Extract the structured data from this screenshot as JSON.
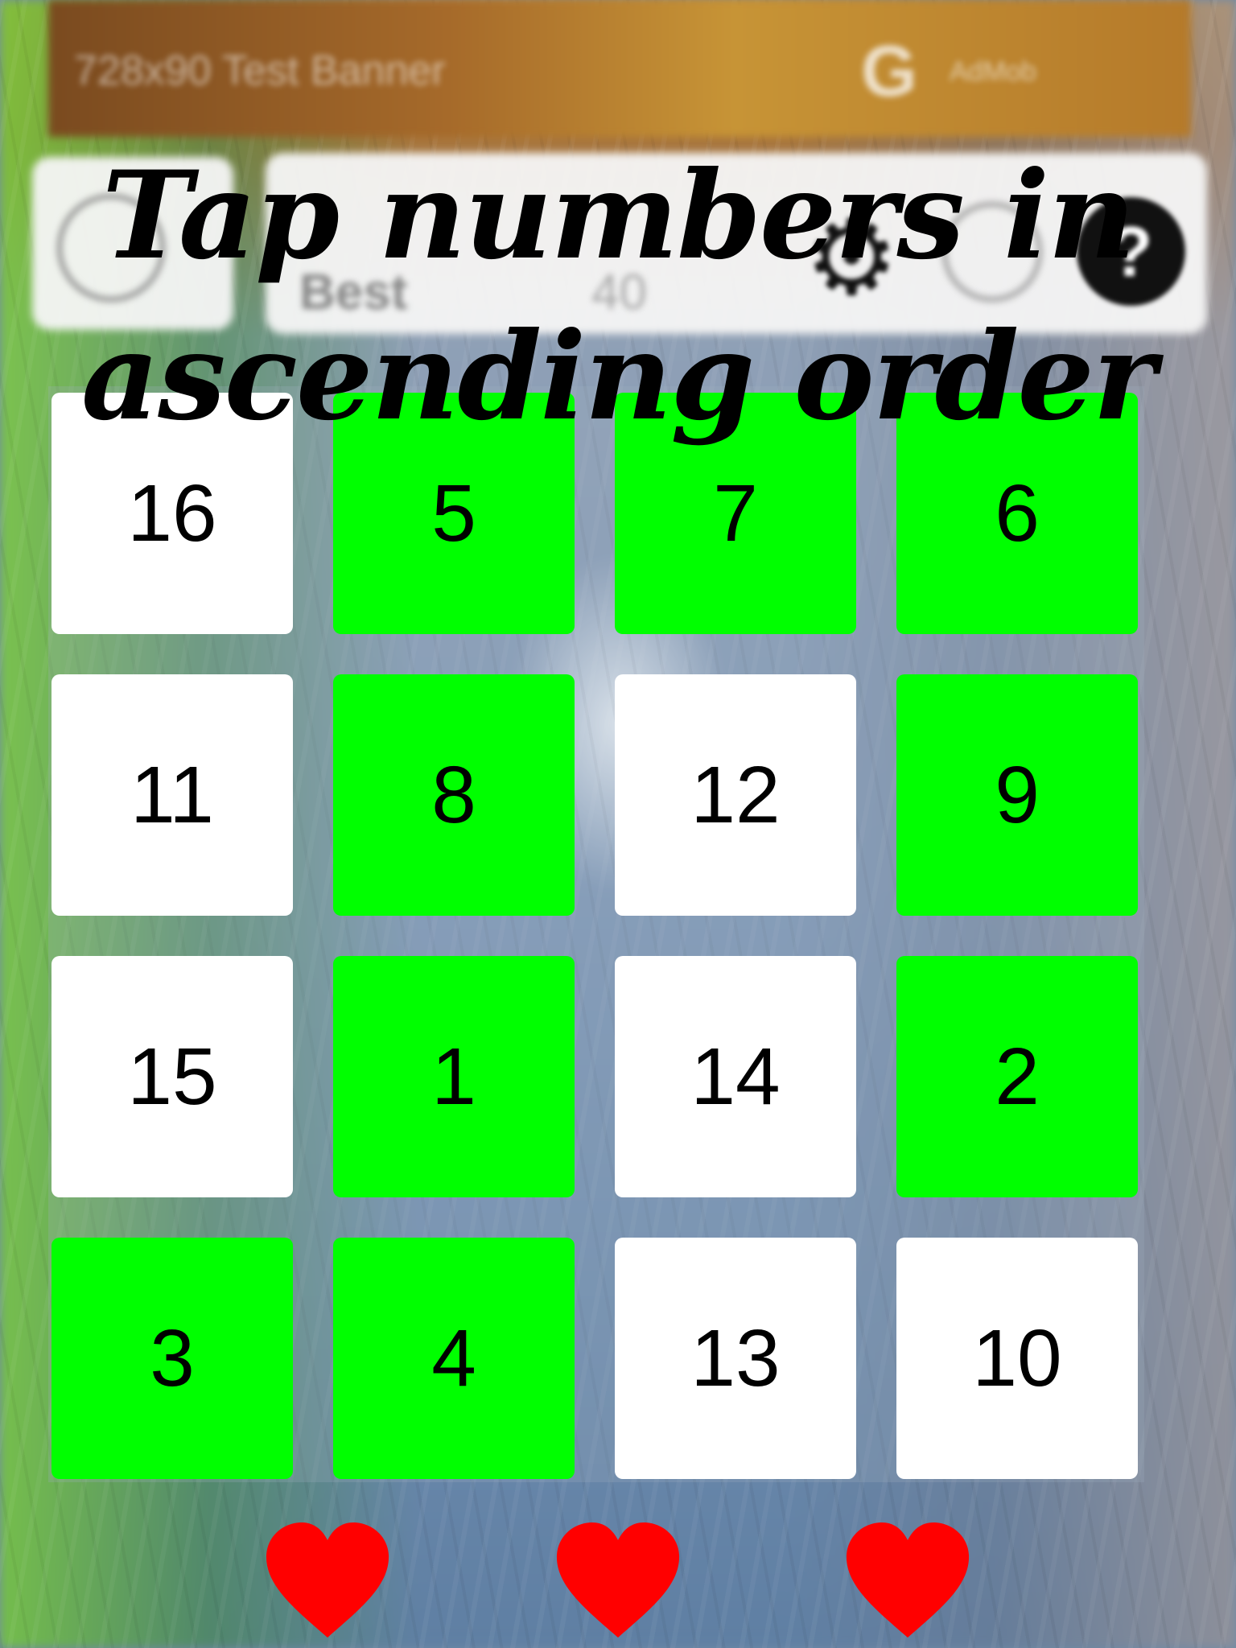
{
  "ad_banner": {
    "text": "728x90 Test Banner",
    "logo": "G",
    "logo_text": "AdMob"
  },
  "hud": {
    "best_label": "Best",
    "best_value": "40",
    "settings_icon": "gear-icon",
    "help_label": "?"
  },
  "title": "Tap numbers in ascending order",
  "tiles": [
    {
      "number": "16",
      "state": "white"
    },
    {
      "number": "5",
      "state": "green"
    },
    {
      "number": "7",
      "state": "green"
    },
    {
      "number": "6",
      "state": "green"
    },
    {
      "number": "11",
      "state": "white"
    },
    {
      "number": "8",
      "state": "green"
    },
    {
      "number": "12",
      "state": "white"
    },
    {
      "number": "9",
      "state": "green"
    },
    {
      "number": "15",
      "state": "white"
    },
    {
      "number": "1",
      "state": "green"
    },
    {
      "number": "14",
      "state": "white"
    },
    {
      "number": "2",
      "state": "green"
    },
    {
      "number": "3",
      "state": "green"
    },
    {
      "number": "4",
      "state": "green"
    },
    {
      "number": "13",
      "state": "white"
    },
    {
      "number": "10",
      "state": "white"
    }
  ],
  "lives": {
    "count": 3,
    "icon": "heart-icon",
    "color": "#ff0000"
  },
  "colors": {
    "tapped_tile": "#00ff00",
    "untapped_tile": "#ffffff"
  }
}
